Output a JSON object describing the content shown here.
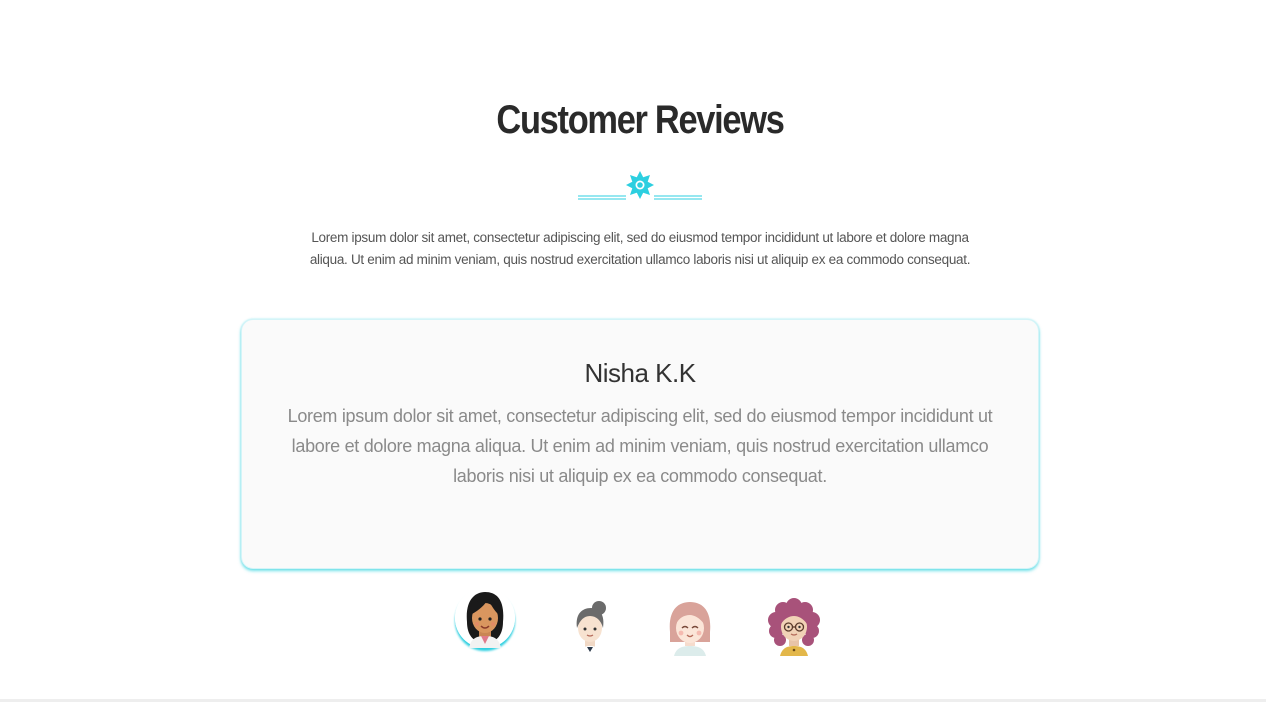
{
  "section": {
    "title": "Customer Reviews",
    "intro": "Lorem ipsum dolor sit amet, consectetur adipiscing elit, sed do eiusmod tempor incididunt ut labore et dolore magna aliqua. Ut enim ad minim veniam, quis nostrud exercitation ullamco laboris nisi ut aliquip ex ea commodo consequat."
  },
  "divider_icon": "sparkle-icon",
  "active_review": {
    "name": "Nisha K.K",
    "text": "Lorem ipsum dolor sit amet, consectetur adipiscing elit, sed do eiusmod tempor incididunt ut labore et dolore magna aliqua. Ut enim ad minim veniam, quis nostrud exercitation ullamco laboris nisi ut aliquip ex ea commodo consequat."
  },
  "avatars": [
    {
      "icon": "woman-dark-hair-avatar-icon",
      "active": true
    },
    {
      "icon": "woman-gray-bun-avatar-icon",
      "active": false
    },
    {
      "icon": "girl-pink-hair-avatar-icon",
      "active": false
    },
    {
      "icon": "woman-curly-purple-hair-glasses-avatar-icon",
      "active": false
    }
  ],
  "colors": {
    "accent": "#2ccfe0",
    "title": "#2a2a2a",
    "body_text": "#555555",
    "review_text": "#8a8a8a",
    "card_bg": "#fafafa"
  }
}
